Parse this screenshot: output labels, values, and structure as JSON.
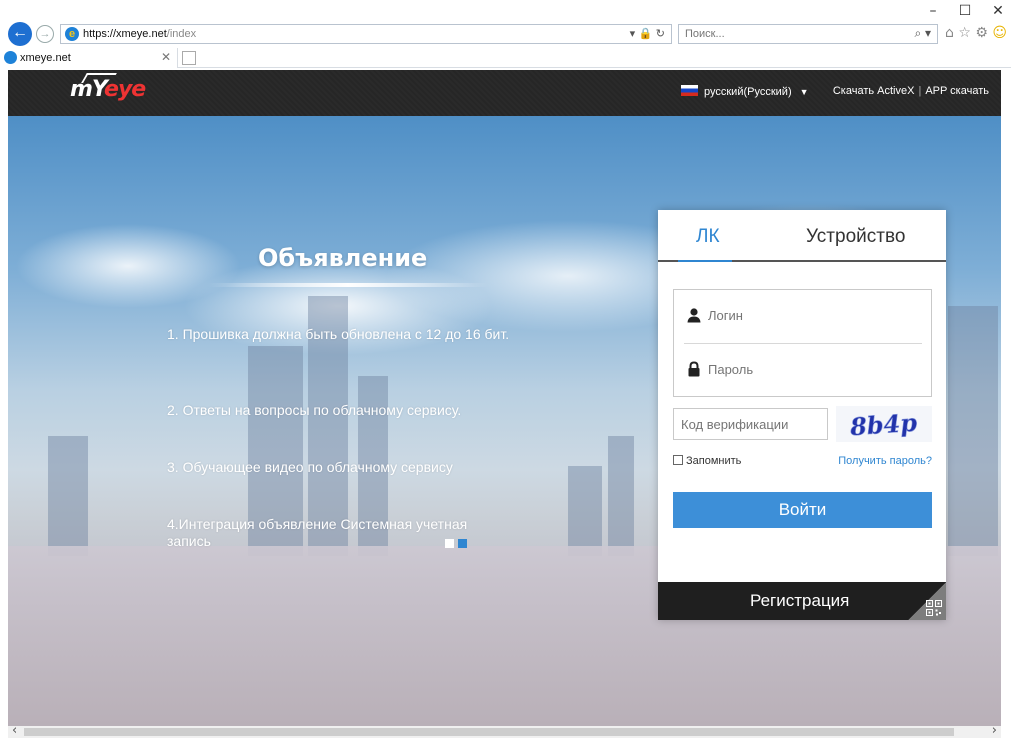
{
  "window": {
    "minimize": "–",
    "maximize": "☐",
    "close": "✕"
  },
  "browser": {
    "url_host": "https://xmeye.net",
    "url_path": "/index",
    "url_icons": "▾ 🔒 ↻",
    "search_placeholder": "Поиск...",
    "search_icon": "⌕ ▾",
    "tool_icons": [
      "home-icon",
      "star-icon",
      "gear-icon",
      "smiley-icon"
    ],
    "tab_title": "xmeye.net",
    "tab_close": "✕"
  },
  "site": {
    "logo_text": "mY",
    "logo_accent": "eye",
    "language": "русский(Русский)",
    "activex_link": "Скачать ActiveX",
    "app_link": "APP скачать",
    "separator": "|"
  },
  "announcement": {
    "title": "Объявление",
    "items": [
      "1. Прошивка должна быть обновлена с 12 до 16 бит.",
      "2. Ответы на вопросы по облачному сервису.",
      "3. Обучающее видео по облачному сервису",
      "4.Интеграция объявление Системная учетная запись"
    ],
    "dots": [
      "#ffffff",
      "#2f86d1"
    ]
  },
  "login": {
    "tab_account": "ЛК",
    "tab_device": "Устройство",
    "username_placeholder": "Логин",
    "password_placeholder": "Пароль",
    "verify_placeholder": "Код верификации",
    "captcha_text": "8b4p",
    "remember_label": "Запомнить",
    "forgot_link": "Получить пароль?",
    "login_button": "Войти",
    "register_button": "Регистрация"
  },
  "colors": {
    "accent": "#2f86d1",
    "button": "#3d8fd8",
    "header": "#262626"
  }
}
